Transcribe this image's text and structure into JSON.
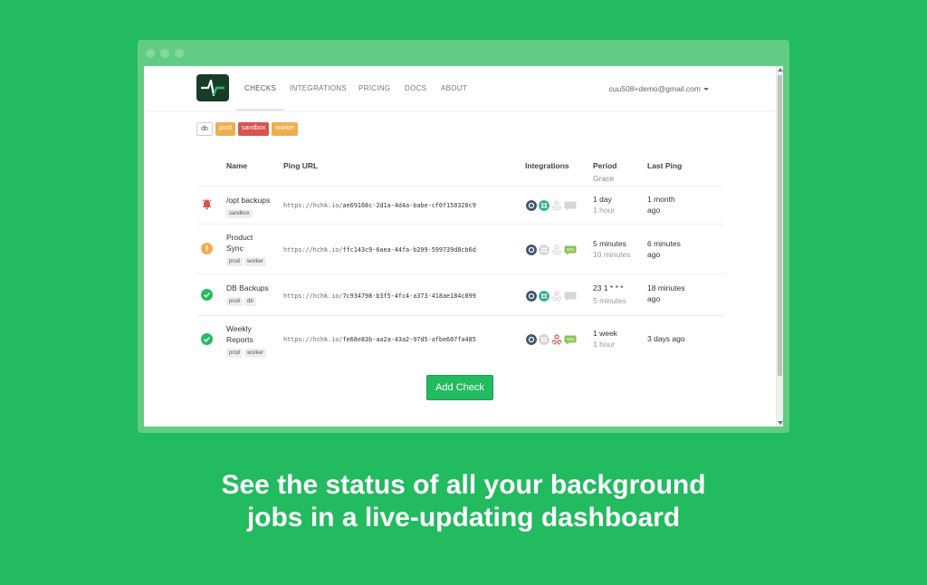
{
  "nav": {
    "items": [
      {
        "label": "CHECKS",
        "active": true
      },
      {
        "label": "INTEGRATIONS",
        "active": false
      },
      {
        "label": "PRICING",
        "active": false
      },
      {
        "label": "DOCS",
        "active": false
      },
      {
        "label": "ABOUT",
        "active": false
      }
    ],
    "user": "cuu508+demo@gmail.com"
  },
  "filters": [
    {
      "label": "db",
      "style": "plain"
    },
    {
      "label": "prod",
      "style": "orange"
    },
    {
      "label": "sandbox",
      "style": "red"
    },
    {
      "label": "worker",
      "style": "orange"
    }
  ],
  "table": {
    "headers": {
      "name": "Name",
      "ping_url": "Ping URL",
      "integrations": "Integrations",
      "period": "Period",
      "grace": "Grace",
      "last_ping": "Last Ping"
    },
    "rows": [
      {
        "status": "down",
        "name": [
          "/opt backups"
        ],
        "tags": [
          "sandbox"
        ],
        "url_base": "https://hchk.io/",
        "uuid": "ae69168c-2d1a-4d4a-babe-cf0f150320c9",
        "period": "1 day",
        "grace": "1 hour",
        "last_ping": [
          "1 month",
          "ago"
        ],
        "integrations": [
          "email-on",
          "slack-on",
          "webhook-off",
          "sms-off"
        ]
      },
      {
        "status": "grace",
        "name": [
          "Product",
          "Sync"
        ],
        "tags": [
          "prod",
          "worker"
        ],
        "url_base": "https://hchk.io/",
        "uuid": "ffc143c9-6aea-44fa-b299-599739d8cb6d",
        "period": "5 minutes",
        "grace": "10 minutes",
        "last_ping": [
          "6 minutes",
          "ago"
        ],
        "integrations": [
          "email-on",
          "slack-off",
          "webhook-off",
          "sms-on"
        ]
      },
      {
        "status": "up",
        "name": [
          "DB Backups"
        ],
        "tags": [
          "prod",
          "db"
        ],
        "url_base": "https://hchk.io/",
        "uuid": "7c934798-b3f5-4fc4-a373-418ae184c899",
        "period": "23 1 * * *",
        "grace": "5 minutes",
        "last_ping": [
          "18 minutes",
          "ago"
        ],
        "integrations": [
          "email-on",
          "slack-on",
          "webhook-off",
          "sms-off"
        ]
      },
      {
        "status": "up",
        "name": [
          "Weekly",
          "Reports"
        ],
        "tags": [
          "prod",
          "worker"
        ],
        "url_base": "https://hchk.io/",
        "uuid": "fe68e83b-aa2a-43a2-97d5-afbe607fa485",
        "period": "1 week",
        "grace": "1 hour",
        "last_ping": [
          "3 days ago"
        ],
        "integrations": [
          "email-on",
          "slack-off",
          "webhook-on",
          "sms-on"
        ]
      }
    ]
  },
  "add_check_label": "Add Check",
  "tagline": [
    "See the status of all your background",
    "jobs in a live-updating dashboard"
  ],
  "sms_icon_text": "SMS",
  "colors": {
    "background": "#22bb5f",
    "up": "#22bb5f",
    "grace": "#f0ad4e",
    "down": "#d9534f",
    "email": "#41566f",
    "slack": "#3bb08f",
    "webhook": "#d9534f",
    "sms": "#8cc152",
    "inactive": "#d6d6d6"
  }
}
